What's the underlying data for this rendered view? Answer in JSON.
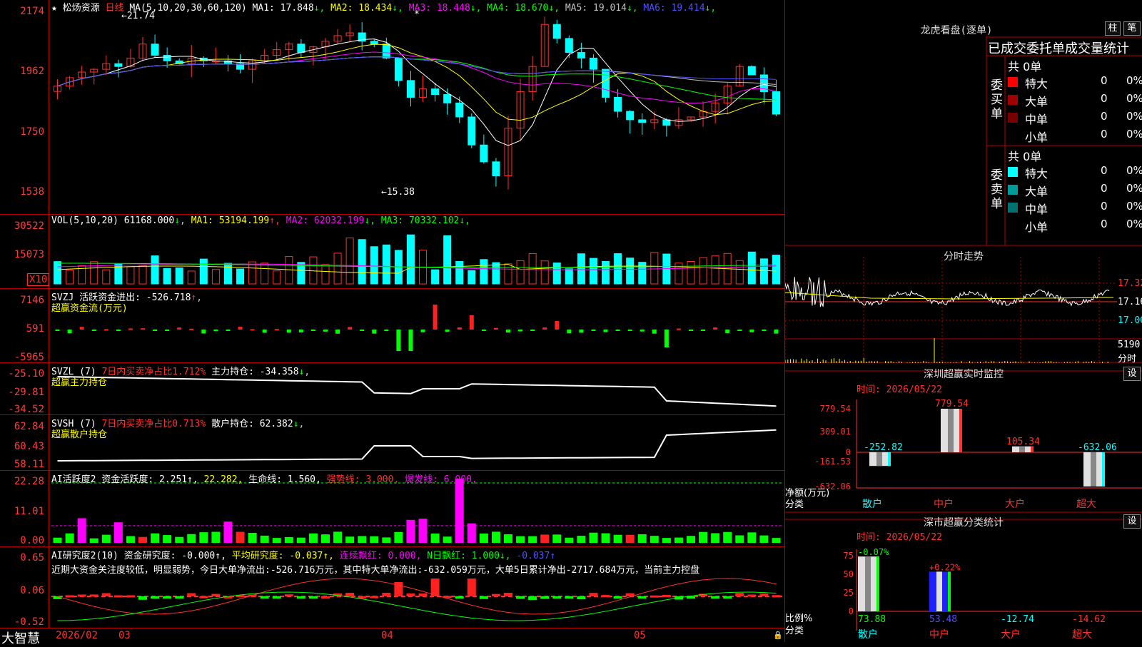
{
  "stock": {
    "name": "松炀资源",
    "period": "日线",
    "star": "★"
  },
  "main_panel": {
    "ma_header": "MA(5,10,20,30,60,120)",
    "ma": [
      {
        "label": "MA1:",
        "value": "17.848",
        "arrow": "↓",
        "color": "#ffffff"
      },
      {
        "label": "MA2:",
        "value": "18.434",
        "arrow": "↓",
        "color": "#ffff00"
      },
      {
        "label": "MA3:",
        "value": "18.448",
        "arrow": "↓",
        "color": "#ff00ff"
      },
      {
        "label": "MA4:",
        "value": "18.670",
        "arrow": "↓",
        "color": "#00ff00"
      },
      {
        "label": "MA5:",
        "value": "19.014",
        "arrow": "↓",
        "color": "#c0c0c0"
      },
      {
        "label": "MA6:",
        "value": "19.414",
        "arrow": "↓",
        "color": "#5050ff"
      }
    ],
    "y_labels": [
      "2174",
      "1962",
      "1750",
      "1538"
    ],
    "high_mark": "21.74",
    "low_mark": "15.38",
    "asterisk": "*"
  },
  "vol_panel": {
    "header": "VOL(5,10,20)",
    "value": "61168.000",
    "arrow": "↓",
    "ma": [
      {
        "label": "MA1:",
        "value": "53194.199",
        "arrow": "↑",
        "color": "#ffff00"
      },
      {
        "label": "MA2:",
        "value": "62032.199",
        "arrow": "↓",
        "color": "#ff00ff"
      },
      {
        "label": "MA3:",
        "value": "70332.102",
        "arrow": "↓",
        "color": "#00ff00"
      }
    ],
    "y_labels": [
      "30522",
      "15073"
    ],
    "unit": "X10"
  },
  "svzj_panel": {
    "header": "SVZJ",
    "label": "活跃资金进出:",
    "value": "-526.718",
    "arrow": "↑",
    "subtitle": "超赢资金流(万元)",
    "y_labels": [
      "7146",
      "591",
      "-5965"
    ]
  },
  "svzl_panel": {
    "header": "SVZL  (7)",
    "label1": "7日内买卖净占比1.712%",
    "label2": "主力持仓:",
    "value": "-34.358",
    "arrow": "↓",
    "subtitle": "超赢主力持仓",
    "y_labels": [
      "-25.10",
      "-29.81",
      "-34.52"
    ]
  },
  "svsh_panel": {
    "header": "SVSH  (7)",
    "label1": "7日内买卖净占比0.713%",
    "label2": "散户持仓:",
    "value": "62.382",
    "arrow": "↓",
    "subtitle": "超赢散户持仓",
    "y_labels": [
      "62.84",
      "60.43",
      "58.11"
    ]
  },
  "ai_active_panel": {
    "header": "AI活跃度2",
    "items": [
      {
        "text": "资金活跃度: 2.251↑,",
        "color": "#ffffff"
      },
      {
        "text": "22.282,",
        "color": "#ffff00"
      },
      {
        "text": "生命线: 1.560,",
        "color": "#ffffff"
      },
      {
        "text": "强势线: 3.000,",
        "color": "#ff3030"
      },
      {
        "text": "爆发线: 6.000,",
        "color": "#ff00ff"
      }
    ],
    "y_labels": [
      "22.28",
      "11.01",
      "0.00"
    ]
  },
  "ai_research_panel": {
    "header": "AI研究度2(10)",
    "items": [
      {
        "text": "资金研究度: -0.000↑,",
        "color": "#ffffff"
      },
      {
        "text": "平均研究度: -0.037↑,",
        "color": "#ffff00"
      },
      {
        "text": "连续飘红: 0.000,",
        "color": "#ff00ff"
      },
      {
        "text": "N日飘红: 1.000↓,",
        "color": "#00ff00"
      },
      {
        "text": "-0.037↑",
        "color": "#5050ff"
      }
    ],
    "comment": "近期大资金关注度较低，明显弱势，今日大单净流出:-526.716万元，其中特大单净流出:-632.059万元，大单5日累计净出-2717.684万元，当前主力控盘",
    "y_labels": [
      "0.65",
      "0.06",
      "-0.52"
    ]
  },
  "x_axis": {
    "brand": "大智慧",
    "labels": [
      "2026/02",
      "03",
      "04",
      "05"
    ]
  },
  "lhb": {
    "title": "龙虎看盘(逐单)",
    "btn1": "柱",
    "btn2": "笔",
    "tabs": "已成交委托单成交量统计",
    "buy_label": "委买单",
    "sell_label": "委卖单",
    "buy_total": "共 0单",
    "sell_total": "共 0单",
    "buy_rows": [
      {
        "name": "特大",
        "count": "0",
        "pct": "0%",
        "color": "#ff0000"
      },
      {
        "name": "大单",
        "count": "0",
        "pct": "0%",
        "color": "#a00000"
      },
      {
        "name": "中单",
        "count": "0",
        "pct": "0%",
        "color": "#780000"
      },
      {
        "name": "小单",
        "count": "0",
        "pct": "0%",
        "color": ""
      }
    ],
    "sell_rows": [
      {
        "name": "特大",
        "count": "0",
        "pct": "0%",
        "color": "#00ffff"
      },
      {
        "name": "大单",
        "count": "0",
        "pct": "0%",
        "color": "#009a9a"
      },
      {
        "name": "中单",
        "count": "0",
        "pct": "0%",
        "color": "#007070"
      },
      {
        "name": "小单",
        "count": "0",
        "pct": "0%",
        "color": ""
      }
    ]
  },
  "intraday": {
    "title": "分时走势",
    "price_labels": [
      "17.32",
      "17.16",
      "17.00"
    ],
    "vol_label": "5190",
    "vol_unit": "分时"
  },
  "sz_monitor": {
    "title": "深圳超赢实时监控",
    "btn": "设",
    "time": "时间: 2026/05/22",
    "y_labels": [
      "779.54",
      "309.01",
      "0",
      "-161.53",
      "-632.06"
    ],
    "net_label": "净额(万元)",
    "cat_label": "分类",
    "bars": [
      {
        "name": "散户",
        "value": -252.82,
        "label": "-252.82",
        "color": "#00ffff"
      },
      {
        "name": "中户",
        "value": 779.54,
        "label": "779.54",
        "color": "#ff3030"
      },
      {
        "name": "大户",
        "value": 105.34,
        "label": "105.34",
        "color": "#ff3030"
      },
      {
        "name": "超大",
        "value": -632.06,
        "label": "-632.06",
        "color": "#00ffff"
      }
    ],
    "name_colors": [
      "#00ffff",
      "#ff3030",
      "#ff3030",
      "#ff3030"
    ]
  },
  "sz_class": {
    "title": "深市超赢分类统计",
    "btn": "设",
    "time": "时间: 2026/05/22",
    "y_labels": [
      "75",
      "50",
      "25",
      "0"
    ],
    "ratio_label": "比例%",
    "cat_label": "分类",
    "bars": [
      {
        "name": "散户",
        "value": 73.88,
        "label": "73.88",
        "change": "-0.07%",
        "change_color": "#00ff00"
      },
      {
        "name": "中户",
        "value": 53.48,
        "label": "53.48",
        "change": "+0.22%",
        "change_color": "#ff3030"
      },
      {
        "name": "大户",
        "value": -12.74,
        "label": "-12.74",
        "change": "",
        "change_color": ""
      },
      {
        "name": "超大",
        "value": -14.62,
        "label": "-14.62",
        "change": "",
        "change_color": ""
      }
    ],
    "name_colors": [
      "#00ffff",
      "#ff3030",
      "#ff3030",
      "#ff3030"
    ],
    "label_colors": [
      "#00ff00",
      "#5050ff",
      "#00ffff",
      "#ff3030"
    ]
  }
}
